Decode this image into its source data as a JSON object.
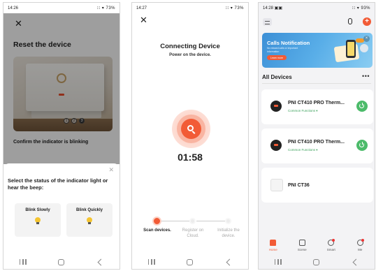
{
  "phone1": {
    "status_time": "14:26",
    "status_battery": "73%",
    "title": "Reset the device",
    "pager": [
      "1",
      "2",
      "3"
    ],
    "confirm_text": "Confirm the indicator is blinking",
    "sheet_title": "Select the status of the indicator light or hear the beep:",
    "option_slow": "Blink Slowly",
    "option_quick": "Blink Quickly"
  },
  "phone2": {
    "status_time": "14:27",
    "status_battery": "73%",
    "title": "Connecting Device",
    "subtitle": "Power on the device.",
    "timer": "01:58",
    "steps": [
      {
        "label": "Scan devices.",
        "state": "active"
      },
      {
        "label": "Register on Cloud.",
        "state": "pending"
      },
      {
        "label": "Initialize the device.",
        "state": "pending"
      }
    ]
  },
  "phone3": {
    "status_time": "14:28",
    "status_battery": "93%",
    "banner": {
      "title": "Calls Notification",
      "subtitle": "No missed calls or important information",
      "button": "Learn more"
    },
    "section_title": "All Devices",
    "devices": [
      {
        "name": "PNI CT410 PRO Therm...",
        "functions": "Common Functions ▾",
        "has_power": true
      },
      {
        "name": "PNI CT410 PRO Therm...",
        "functions": "Common Functions ▾",
        "has_power": true
      },
      {
        "name": "PNI CT36",
        "functions": "",
        "has_power": false
      }
    ],
    "tabs": [
      {
        "label": "Home",
        "icon": "home-icon",
        "active": true
      },
      {
        "label": "Scene",
        "icon": "scene-icon",
        "active": false
      },
      {
        "label": "Smart",
        "icon": "smart-icon",
        "active": false
      },
      {
        "label": "Me",
        "icon": "me-icon",
        "active": false
      }
    ]
  },
  "colors": {
    "accent": "#f25b36",
    "power_green": "#4cbb6a",
    "function_green": "#3aa15a",
    "banner_blue": "#3c8fd6"
  }
}
